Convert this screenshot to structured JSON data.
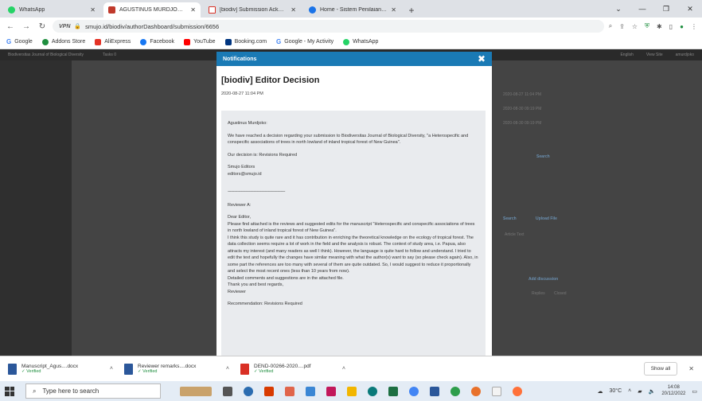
{
  "browser": {
    "tabs": [
      {
        "title": "WhatsApp",
        "icon": "whatsapp-icon",
        "active": false
      },
      {
        "title": "AGUSTINUS MURDJOKO, Hetero",
        "icon": "smujo-icon",
        "active": true
      },
      {
        "title": "[biodiv] Submission Acknowledg",
        "icon": "gmail-icon",
        "active": false
      },
      {
        "title": "Home - Sistem Penilaian Angka",
        "icon": "spak-icon",
        "active": false
      }
    ],
    "new_tab": "+",
    "url_prefix": "VPN",
    "url": "smujo.id/biodiv/authorDashboard/submission/6656",
    "bookmarks": [
      "Google",
      "Addons Store",
      "AliExpress",
      "Facebook",
      "YouTube",
      "Booking.com",
      "Google - My Activity",
      "WhatsApp"
    ]
  },
  "background": {
    "journal_name": "Biodiversitas Journal of Biological Diversity",
    "tasks_label": "Tasks",
    "tasks_count": "0",
    "lang_label": "English",
    "view_site": "View Site",
    "user": "amurdjoko",
    "dates": [
      "2020-08-27 11:04 PM",
      "2020-08-30 09:19 PM",
      "2020-08-30 09:19 PM"
    ],
    "search": "Search",
    "upload_file": "Upload File",
    "article_text": "Article Text",
    "add_discussion": "Add discussion",
    "col_replies": "Replies",
    "col_closed": "Closed"
  },
  "modal": {
    "header": "Notifications",
    "title": "[biodiv] Editor Decision",
    "date": "2020-08-27 11:04 PM",
    "greeting": "Agustinus Murdjoko:",
    "body1": "We have reached a decision regarding your submission to Biodiversitas Journal of Biological Diversity, \"a Heterospecific and conspecific associations of trees in north lowland of inland tropical forest of New Guinea\".",
    "decision": "Our decision is: Revisions Required",
    "sig1": "Smujo Editors",
    "sig2": "editors@smujo.id",
    "separator": "------------------------------------------------------",
    "reviewer_heading": "Reviewer A:",
    "dear": "Dear Editor,",
    "review_lines": [
      "Please find attached is the reviews and suggested edits for the manuscript \"Heterospecific and conspecific associations of trees in north lowland of inland tropical forest of New Guinea\".",
      "I think this study is quite rare and it has contribution in enriching the theoretical knowledge on the ecology of tropical forest. The data collection seems require a lot of work in the field and the analysis is robust. The context of study area, i.e. Papua, also attracts my interest (and many readers as well I think). However, the language is quite hard to follow and understand. I tried to edit the text and hopefully the changes have similar meaning with what the author(s) want to say (so please check again). Also, in some part the references are too many with several of them are quite outdated. So, I would suggest to reduce it proportionally and select the most recent ones (less than 10 years from now).",
      "Detailed comments and suggestions are in the attached file.",
      "Thank you and best regards,",
      "Reviewer"
    ],
    "recommendation": "Recommendation: Revisions Required"
  },
  "downloads": [
    {
      "name": "Manuscript_Agus....docx",
      "status": "Verified",
      "type": "docx"
    },
    {
      "name": "Reviewer remarks....docx",
      "status": "Verified",
      "type": "docx"
    },
    {
      "name": "DEND-00266-2020....pdf",
      "status": "Verified",
      "type": "pdf"
    }
  ],
  "show_all": "Show all",
  "taskbar": {
    "search_placeholder": "Type here to search",
    "weather": "30°C",
    "time": "14:08",
    "date": "20/12/2022"
  }
}
